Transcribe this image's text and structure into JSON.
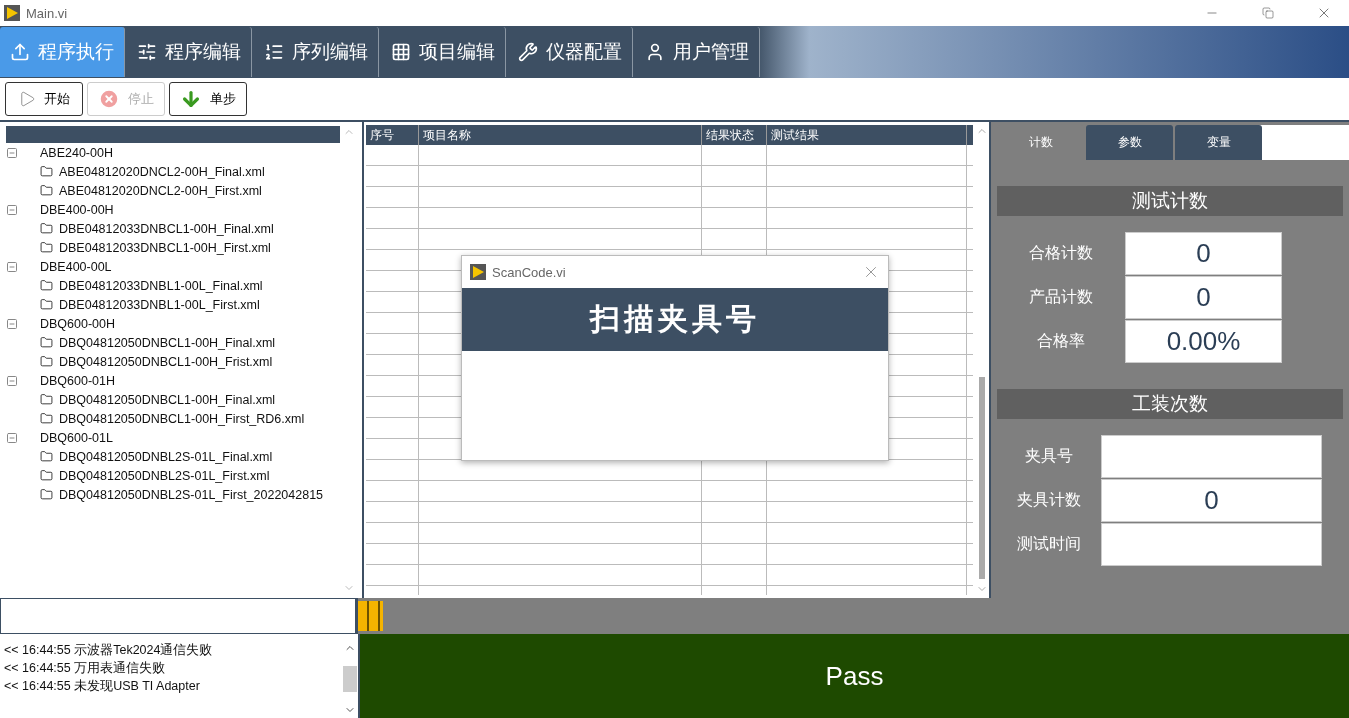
{
  "window": {
    "title": "Main.vi"
  },
  "tabs": [
    {
      "label": "程序执行",
      "selected": true
    },
    {
      "label": "程序编辑",
      "selected": false
    },
    {
      "label": "序列编辑",
      "selected": false
    },
    {
      "label": "项目编辑",
      "selected": false
    },
    {
      "label": "仪器配置",
      "selected": false
    },
    {
      "label": "用户管理",
      "selected": false
    }
  ],
  "toolbar": [
    {
      "label": "开始",
      "disabled": false
    },
    {
      "label": "停止",
      "disabled": true
    },
    {
      "label": "单步",
      "disabled": false
    }
  ],
  "tree": [
    {
      "label": "ABE240-00H",
      "expanded": true,
      "children": [
        {
          "label": "ABE04812020DNCL2-00H_Final.xml"
        },
        {
          "label": "ABE04812020DNCL2-00H_First.xml"
        }
      ]
    },
    {
      "label": "DBE400-00H",
      "expanded": true,
      "children": [
        {
          "label": "DBE04812033DNBCL1-00H_Final.xml"
        },
        {
          "label": "DBE04812033DNBCL1-00H_First.xml"
        }
      ]
    },
    {
      "label": "DBE400-00L",
      "expanded": true,
      "children": [
        {
          "label": "DBE04812033DNBL1-00L_Final.xml"
        },
        {
          "label": "DBE04812033DNBL1-00L_First.xml"
        }
      ]
    },
    {
      "label": "DBQ600-00H",
      "expanded": true,
      "children": [
        {
          "label": "DBQ04812050DNBCL1-00H_Final.xml"
        },
        {
          "label": "DBQ04812050DNBCL1-00H_Frist.xml"
        }
      ]
    },
    {
      "label": "DBQ600-01H",
      "expanded": true,
      "children": [
        {
          "label": "DBQ04812050DNBCL1-00H_Final.xml"
        },
        {
          "label": "DBQ04812050DNBCL1-00H_First_RD6.xml"
        }
      ]
    },
    {
      "label": "DBQ600-01L",
      "expanded": true,
      "children": [
        {
          "label": "DBQ04812050DNBL2S-01L_Final.xml"
        },
        {
          "label": "DBQ04812050DNBL2S-01L_First.xml"
        },
        {
          "label": "DBQ04812050DNBL2S-01L_First_2022042815"
        }
      ]
    }
  ],
  "table": {
    "columns": [
      "序号",
      "项目名称",
      "结果状态",
      "测试结果"
    ]
  },
  "dialog": {
    "title": "ScanCode.vi",
    "heading": "扫描夹具号"
  },
  "side_tabs": [
    {
      "label": "计数",
      "selected": true
    },
    {
      "label": "参数",
      "selected": false
    },
    {
      "label": "变量",
      "selected": false
    }
  ],
  "sections": [
    {
      "title": "测试计数",
      "fields": [
        {
          "label": "合格计数",
          "value": "0"
        },
        {
          "label": "产品计数",
          "value": "0"
        },
        {
          "label": "合格率",
          "value": "0.00%"
        }
      ]
    },
    {
      "title": "工装次数",
      "fields": [
        {
          "label": "夹具号"
        },
        {
          "label": "夹具计数",
          "value": "0"
        },
        {
          "label": "测试时间"
        }
      ]
    }
  ],
  "progress": {
    "level": 0.025
  },
  "log": [
    "<< 16:44:55 示波器Tek2024通信失败",
    "<< 16:44:55 万用表通信失败",
    "<< 16:44:55 未发现USB TI Adapter"
  ],
  "result": {
    "text": "Pass"
  }
}
